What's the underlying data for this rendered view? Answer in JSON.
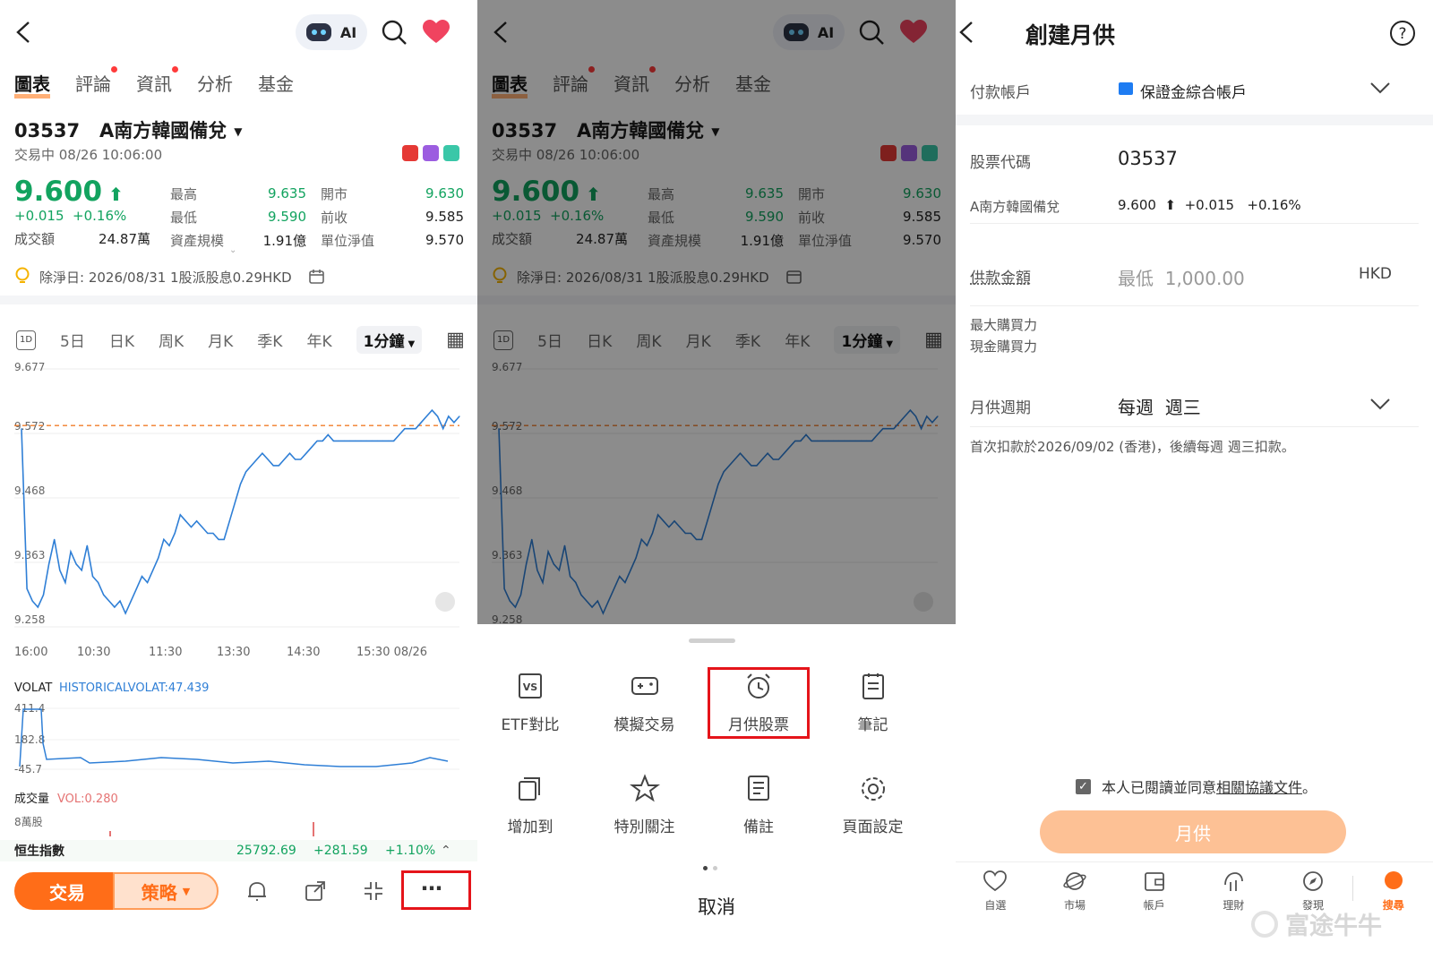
{
  "panel1": {
    "ai_label": "AI",
    "tabs": [
      {
        "label": "圖表",
        "active": true,
        "dot": false
      },
      {
        "label": "評論",
        "active": false,
        "dot": true
      },
      {
        "label": "資訊",
        "active": false,
        "dot": true
      },
      {
        "label": "分析",
        "active": false,
        "dot": false
      },
      {
        "label": "基金",
        "active": false,
        "dot": false
      }
    ],
    "stock": {
      "code_name": "03537   A南方韓國備兌",
      "status": "交易中 08/26 10:06:00",
      "price": "9.600",
      "change": "+0.015  +0.16%",
      "turnover_label": "成交額",
      "turnover_value": "24.87萬",
      "stats": [
        {
          "l1": "最高",
          "v1": "9.635",
          "l2": "開市",
          "v2": "9.630",
          "green": true
        },
        {
          "l1": "最低",
          "v1": "9.590",
          "l2": "前收",
          "v2": "9.585",
          "green": true
        },
        {
          "l1": "資產規模",
          "v1": "1.91億",
          "l2": "單位淨值",
          "v2": "9.570",
          "green": false
        }
      ]
    },
    "dividend_note": "除淨日: 2026/08/31 1股派股息0.29HKD",
    "periods": [
      "5日",
      "日K",
      "周K",
      "月K",
      "季K",
      "年K"
    ],
    "period_icon_label": "1D",
    "selected_period": "1分鐘",
    "volat_title": "VOLAT",
    "volat_value": "HISTORICALVOLAT:47.439",
    "volume_title": "成交量",
    "volume_value": "VOL:0.280",
    "volume_tick": "8萬股",
    "hsi": {
      "name": "恒生指數",
      "value": "25792.69",
      "change": "+281.59",
      "pct": "+1.10%"
    },
    "trade_button": "交易",
    "strategy_button": "策略",
    "more_label": "⋯"
  },
  "panel2": {
    "actions": [
      {
        "label": "ETF對比",
        "icon": "vs-icon"
      },
      {
        "label": "模擬交易",
        "icon": "gamepad-icon"
      },
      {
        "label": "月供股票",
        "icon": "alarm-clock-icon"
      },
      {
        "label": "筆記",
        "icon": "note-icon"
      },
      {
        "label": "增加到",
        "icon": "copy-icon"
      },
      {
        "label": "特別關注",
        "icon": "star-icon"
      },
      {
        "label": "備註",
        "icon": "memo-icon"
      },
      {
        "label": "頁面設定",
        "icon": "gear-icon"
      }
    ],
    "cancel": "取消"
  },
  "panel3": {
    "title": "創建月供",
    "payment_account_label": "付款帳戶",
    "payment_account_value": "保證金綜合帳戶",
    "stock_code_label": "股票代碼",
    "stock_code_value": "03537",
    "stock_name": "A南方韓國備兌",
    "stock_quote": "9.600  ⬆  +0.015   +0.16%",
    "amount_label": "供款金額",
    "amount_placeholder": "最低  1,000.00",
    "amount_currency": "HKD",
    "max_power_label": "最大購買力",
    "cash_power_label": "現金購買力",
    "cycle_label": "月供週期",
    "cycle_value": "每週  週三",
    "first_debit_note": "首次扣款於2026/09/02 (香港)，後續每週 週三扣款。",
    "agree_prefix": "本人已閱讀並同意",
    "agree_link": "相關協議文件",
    "agree_suffix": "。",
    "submit": "月供",
    "nav": [
      {
        "label": "自選",
        "icon": "heart-icon"
      },
      {
        "label": "市場",
        "icon": "planet-icon"
      },
      {
        "label": "帳戶",
        "icon": "wallet-icon"
      },
      {
        "label": "理財",
        "icon": "finance-icon"
      },
      {
        "label": "發現",
        "icon": "compass-icon"
      },
      {
        "label": "搜尋",
        "icon": "avatar-icon",
        "active": true
      }
    ],
    "watermark": "富途牛牛"
  },
  "chart_data": {
    "type": "line",
    "title": "",
    "x_ticks": [
      "16:00",
      "10:30",
      "11:30",
      "13:30",
      "14:30",
      "15:30 08/26"
    ],
    "y_ticks": [
      "9.677",
      "9.572",
      "9.468",
      "9.363",
      "9.258"
    ],
    "ylim": [
      9.258,
      9.677
    ],
    "reference_line": 9.585,
    "series": [
      {
        "values": [
          9.58,
          9.32,
          9.3,
          9.29,
          9.31,
          9.36,
          9.4,
          9.35,
          9.33,
          9.38,
          9.36,
          9.35,
          9.39,
          9.34,
          9.33,
          9.31,
          9.3,
          9.29,
          9.3,
          9.28,
          9.3,
          9.32,
          9.34,
          9.33,
          9.35,
          9.37,
          9.4,
          9.39,
          9.41,
          9.44,
          9.43,
          9.42,
          9.43,
          9.42,
          9.41,
          9.41,
          9.4,
          9.4,
          9.43,
          9.46,
          9.49,
          9.51,
          9.52,
          9.53,
          9.54,
          9.53,
          9.52,
          9.52,
          9.53,
          9.54,
          9.53,
          9.53,
          9.54,
          9.55,
          9.56,
          9.56,
          9.57,
          9.56,
          9.56,
          9.56,
          9.56,
          9.56,
          9.56,
          9.56,
          9.56,
          9.56,
          9.56,
          9.56,
          9.56,
          9.57,
          9.58,
          9.58,
          9.58,
          9.59,
          9.6,
          9.61,
          9.6,
          9.58,
          9.6,
          9.59,
          9.6
        ]
      }
    ],
    "sub_charts": [
      {
        "name": "VOLAT",
        "y_ticks": [
          "411.4",
          "182.8",
          "-45.7"
        ]
      },
      {
        "name": "成交量",
        "y_ticks": [
          "8萬股"
        ]
      }
    ]
  }
}
